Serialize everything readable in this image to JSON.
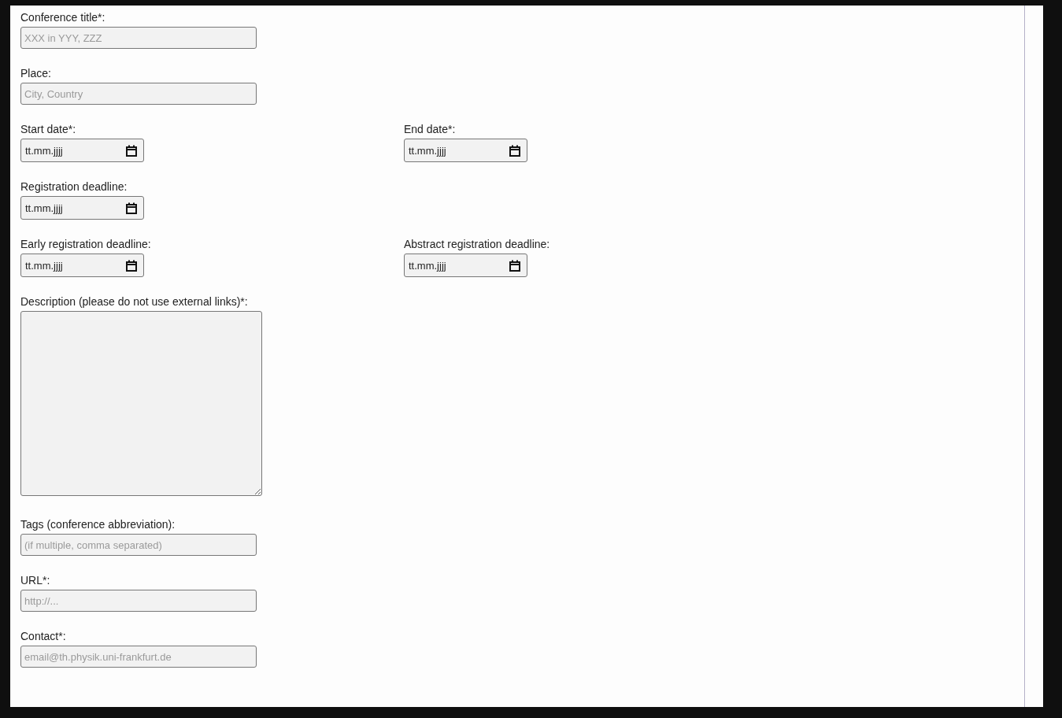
{
  "form": {
    "rows": [
      {
        "fields": [
          {
            "kind": "text",
            "label": "Conference title*:",
            "placeholder": "XXX in YYY, ZZZ"
          }
        ]
      },
      {
        "fields": [
          {
            "kind": "text",
            "label": "Place:",
            "placeholder": "City, Country"
          }
        ]
      },
      {
        "fields": [
          {
            "kind": "date",
            "label": "Start date*:",
            "placeholder": "tt.mm.jjjj"
          },
          {
            "kind": "date",
            "label": "End date*:",
            "placeholder": "tt.mm.jjjj"
          }
        ]
      },
      {
        "fields": [
          {
            "kind": "date",
            "label": "Registration deadline:",
            "placeholder": "tt.mm.jjjj"
          }
        ]
      },
      {
        "fields": [
          {
            "kind": "date",
            "label": "Early registration deadline:",
            "placeholder": "tt.mm.jjjj"
          },
          {
            "kind": "date",
            "label": "Abstract registration deadline:",
            "placeholder": "tt.mm.jjjj"
          }
        ]
      },
      {
        "fields": [
          {
            "kind": "textarea",
            "label": "Description (please do not use external links)*:"
          }
        ]
      },
      {
        "fields": [
          {
            "kind": "text",
            "label": "Tags (conference abbreviation):",
            "placeholder": "(if multiple, comma separated)"
          }
        ]
      },
      {
        "fields": [
          {
            "kind": "text",
            "label": "URL*:",
            "placeholder": "http://..."
          }
        ]
      },
      {
        "fields": [
          {
            "kind": "text",
            "label": "Contact*:",
            "placeholder": "email@th.physik.uni-frankfurt.de"
          }
        ]
      }
    ]
  }
}
